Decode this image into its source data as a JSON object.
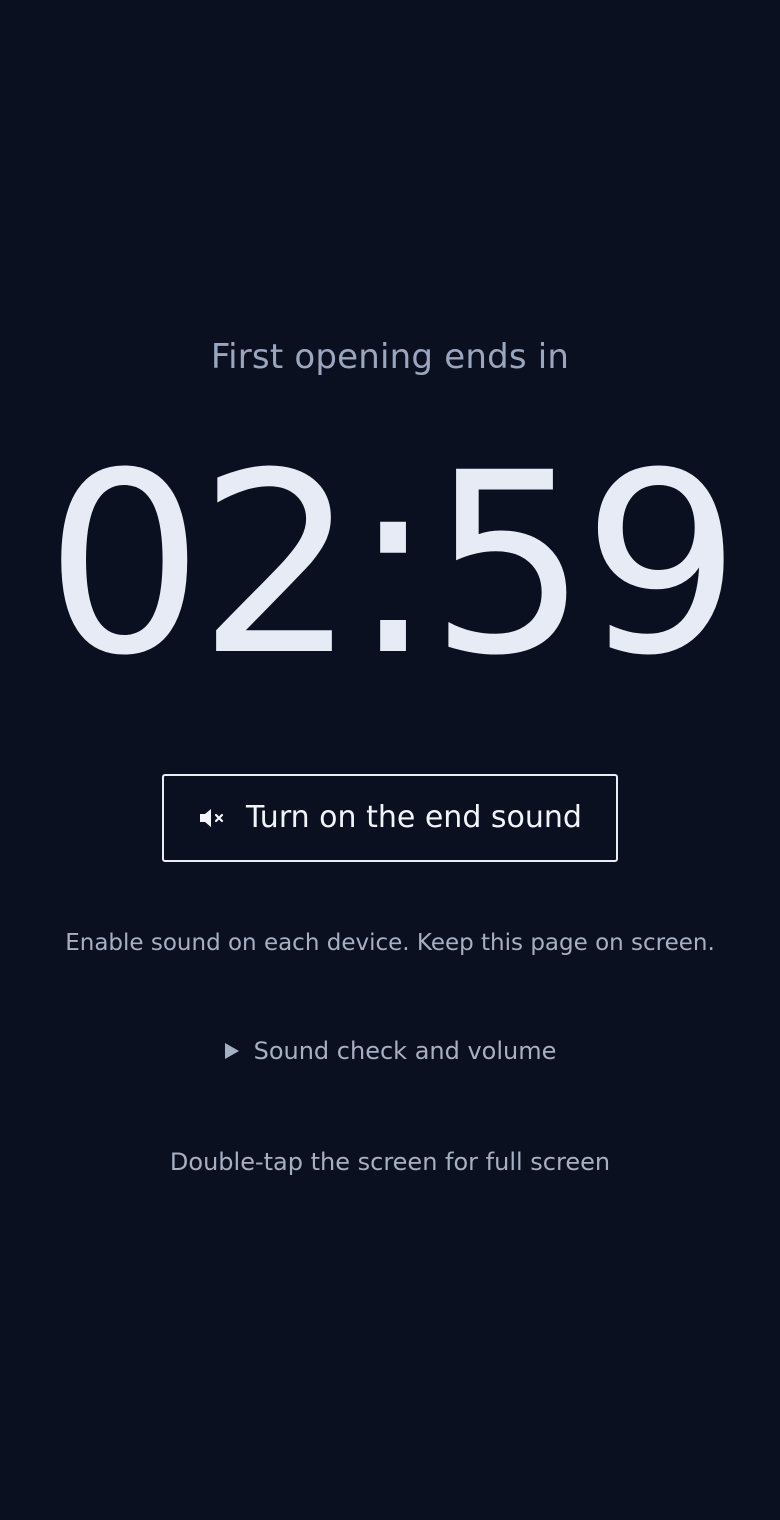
{
  "timer": {
    "phase_label": "First opening ends in",
    "time": "02:59"
  },
  "sound_button": {
    "icon": "speaker-muted-icon",
    "label": "Turn on the end sound"
  },
  "hints": {
    "device_hint": "Enable sound on each device. Keep this page on screen.",
    "sound_check_label": "Sound check and volume",
    "sound_check_icon": "disclosure-triangle-right-icon",
    "fullscreen_hint": "Double-tap the screen for full screen"
  },
  "colors": {
    "background": "#0b1020",
    "text_primary": "#e8edf6",
    "text_secondary": "#9aa6bd"
  }
}
